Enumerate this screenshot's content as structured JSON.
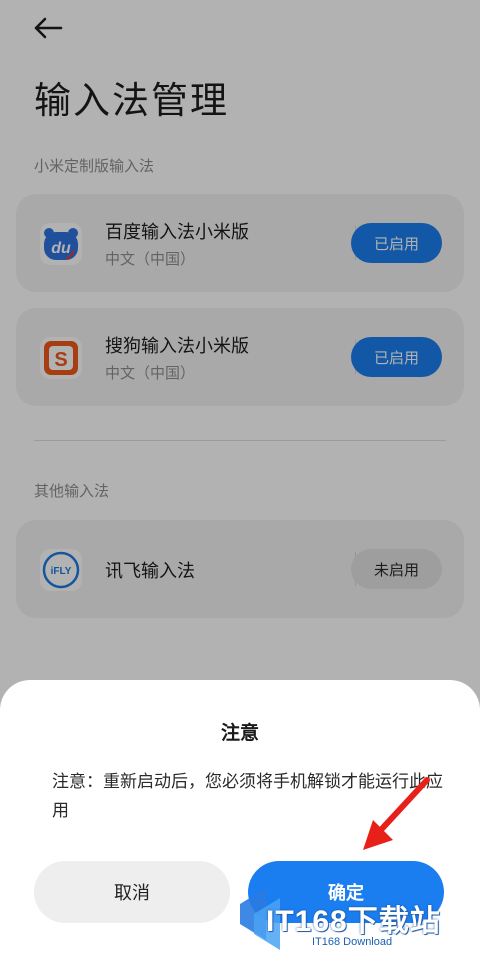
{
  "page": {
    "title": "输入法管理",
    "sections": [
      {
        "label": "小米定制版输入法"
      },
      {
        "label": "其他输入法"
      }
    ]
  },
  "apps": [
    {
      "name": "百度输入法小米版",
      "sub": "中文（中国）",
      "status": "已启用",
      "icon": "baidu-du-icon",
      "icon_text": "du",
      "accent": "#2f73e0"
    },
    {
      "name": "搜狗输入法小米版",
      "sub": "中文（中国）",
      "status": "已启用",
      "icon": "sogou-s-icon",
      "icon_text": "S",
      "accent": "#f05a1a"
    },
    {
      "name": "讯飞输入法",
      "sub": "",
      "status": "未启用",
      "icon": "ifly-icon",
      "icon_text": "iFLY",
      "accent": "#1f7ae0"
    }
  ],
  "dialog": {
    "title": "注意",
    "message": "注意：重新启动后，您必须将手机解锁才能运行此应用",
    "cancel": "取消",
    "confirm": "确定"
  },
  "watermark": {
    "brand": "IT168下载站",
    "sub": "IT168 Download"
  },
  "colors": {
    "primary": "#1a7ef0",
    "arrow": "#e8201a"
  }
}
